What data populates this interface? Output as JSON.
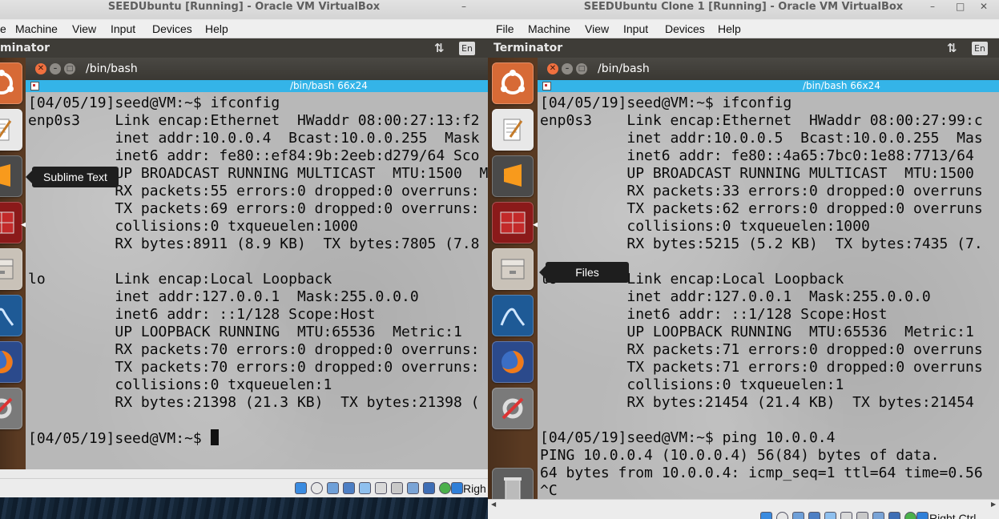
{
  "left_vm": {
    "window_title": "SEEDUbuntu [Running] - Oracle VM VirtualBox",
    "minimize_glyph": "–",
    "menu": [
      "e",
      "Machine",
      "View",
      "Input",
      "Devices",
      "Help"
    ],
    "topbar_title": "minator",
    "tray_lang": "En",
    "tray_sort_icon": "⇅",
    "terminal": {
      "title": "/bin/bash",
      "tab_label": "/bin/bash 66x24",
      "lines": [
        "[04/05/19]seed@VM:~$ ifconfig",
        "enp0s3    Link encap:Ethernet  HWaddr 08:00:27:13:f2",
        "          inet addr:10.0.0.4  Bcast:10.0.0.255  Mask",
        "          inet6 addr: fe80::ef84:9b:2eeb:d279/64 Sco",
        "          UP BROADCAST RUNNING MULTICAST  MTU:1500  M",
        "          RX packets:55 errors:0 dropped:0 overruns:",
        "          TX packets:69 errors:0 dropped:0 overruns:",
        "          collisions:0 txqueuelen:1000",
        "          RX bytes:8911 (8.9 KB)  TX bytes:7805 (7.8",
        "",
        "lo        Link encap:Local Loopback",
        "          inet addr:127.0.0.1  Mask:255.0.0.0",
        "          inet6 addr: ::1/128 Scope:Host",
        "          UP LOOPBACK RUNNING  MTU:65536  Metric:1",
        "          RX packets:70 errors:0 dropped:0 overruns:",
        "          TX packets:70 errors:0 dropped:0 overruns:",
        "          collisions:0 txqueuelen:1",
        "          RX bytes:21398 (21.3 KB)  TX bytes:21398 (",
        "",
        "[04/05/19]seed@VM:~$ "
      ]
    },
    "tooltip": "Sublime Text",
    "host_key": "Righ"
  },
  "right_vm": {
    "window_title": "SEEDUbuntu Clone 1 [Running] - Oracle VM VirtualBox",
    "window_buttons": [
      "–",
      "□",
      "✕"
    ],
    "menu": [
      "File",
      "Machine",
      "View",
      "Input",
      "Devices",
      "Help"
    ],
    "topbar_title": "Terminator",
    "tray_lang": "En",
    "tray_sort_icon": "⇅",
    "terminal": {
      "title": "/bin/bash",
      "tab_label": "/bin/bash 66x24",
      "lines": [
        "[04/05/19]seed@VM:~$ ifconfig",
        "enp0s3    Link encap:Ethernet  HWaddr 08:00:27:99:c",
        "          inet addr:10.0.0.5  Bcast:10.0.0.255  Mas",
        "          inet6 addr: fe80::4a65:7bc0:1e88:7713/64 ",
        "          UP BROADCAST RUNNING MULTICAST  MTU:1500  ",
        "          RX packets:33 errors:0 dropped:0 overruns",
        "          TX packets:62 errors:0 dropped:0 overruns",
        "          collisions:0 txqueuelen:1000",
        "          RX bytes:5215 (5.2 KB)  TX bytes:7435 (7.",
        "",
        "lo        Link encap:Local Loopback",
        "          inet addr:127.0.0.1  Mask:255.0.0.0",
        "          inet6 addr: ::1/128 Scope:Host",
        "          UP LOOPBACK RUNNING  MTU:65536  Metric:1",
        "          RX packets:71 errors:0 dropped:0 overruns",
        "          TX packets:71 errors:0 dropped:0 overruns",
        "          collisions:0 txqueuelen:1",
        "          RX bytes:21454 (21.4 KB)  TX bytes:21454 ",
        "",
        "[04/05/19]seed@VM:~$ ping 10.0.0.4",
        "PING 10.0.0.4 (10.0.0.4) 56(84) bytes of data.",
        "64 bytes from 10.0.0.4: icmp_seq=1 ttl=64 time=0.56",
        "^C"
      ]
    },
    "tooltip": "Files",
    "host_key": "Right Ctrl"
  },
  "colors": {
    "launcher_bg": "#5a3a22",
    "terminal_tab_bar": "#34b4e8",
    "terminal_bg": "#b8b8b8",
    "guest_topbar": "#3e3c37",
    "close_button": "#f0703f"
  },
  "launcher_icons": [
    "ubuntu-dash-icon",
    "text-editor-icon",
    "sublime-text-icon",
    "terminator-icon",
    "files-icon",
    "wireshark-icon",
    "firefox-icon",
    "system-settings-icon",
    "trash-icon"
  ]
}
